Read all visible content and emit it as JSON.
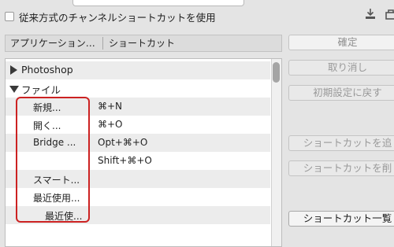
{
  "legacy": {
    "label": "従来方式のチャンネルショートカットを使用"
  },
  "header": {
    "col_app": "アプリケーション…",
    "col_shortcut": "ショートカット"
  },
  "list": [
    {
      "type": "group",
      "label": "Photoshop",
      "expanded": false
    },
    {
      "type": "group",
      "label": "ファイル",
      "expanded": true
    },
    {
      "type": "item",
      "label": "新規...",
      "shortcut": "⌘+N"
    },
    {
      "type": "item",
      "label": "開く...",
      "shortcut": "⌘+O"
    },
    {
      "type": "item",
      "label": "Bridge ...",
      "shortcut": "Opt+⌘+O"
    },
    {
      "type": "item",
      "label": "",
      "shortcut": "Shift+⌘+O"
    },
    {
      "type": "item",
      "label": "スマート...",
      "shortcut": ""
    },
    {
      "type": "item",
      "label": "最近使用...",
      "shortcut": ""
    },
    {
      "type": "item",
      "label": "最近使...",
      "shortcut": "",
      "indent": true
    }
  ],
  "buttons": {
    "ok": "確定",
    "cancel": "取り消し",
    "reset": "初期設定に戻す",
    "accept": "ショートカットを追",
    "delete": "ショートカットを削",
    "summary": "ショートカット一覧"
  }
}
